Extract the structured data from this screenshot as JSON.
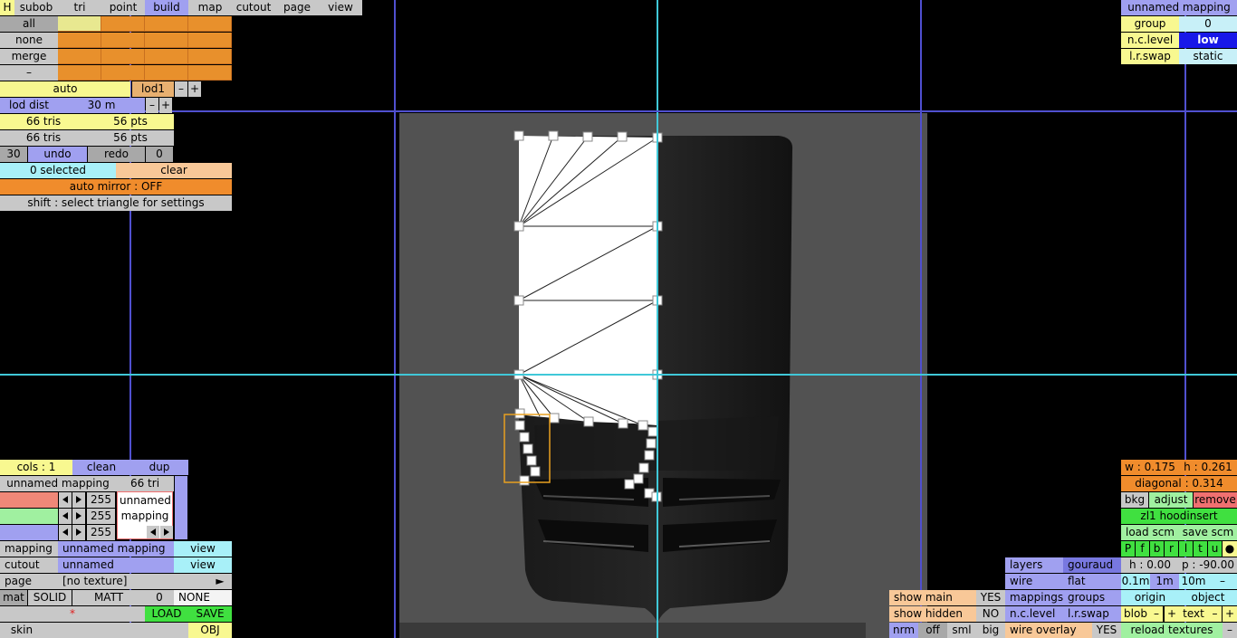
{
  "top_menu": [
    "H",
    "subob",
    "tri",
    "point",
    "build",
    "map",
    "cutout",
    "page",
    "view"
  ],
  "selection": {
    "all": "all",
    "none": "none",
    "merge": "merge",
    "dash": "–"
  },
  "lod": {
    "mode": "auto",
    "level": "lod1",
    "minus": "–",
    "plus": "+",
    "dist_label": "lod dist",
    "dist_value": "30 m"
  },
  "counts": {
    "tris_a": "66 tris",
    "pts_a": "56 pts",
    "tris_b": "66 tris",
    "pts_b": "56 pts"
  },
  "undo": {
    "left_num": "30",
    "undo": "undo",
    "redo": "redo",
    "right_num": "0"
  },
  "select": {
    "selected": "0 selected",
    "clear": "clear",
    "auto_mirror": "auto mirror : OFF",
    "hint": "shift : select triangle for settings"
  },
  "mapping_top_right": {
    "name": "unnamed mapping",
    "group_label": "group",
    "group_value": "0",
    "nc_label": "n.c.level",
    "nc_value": "low",
    "lr_label": "l.r.swap",
    "lr_value": "static"
  },
  "bottom_left": {
    "cols": "cols : 1",
    "clean": "clean",
    "dup": "dup",
    "mapping_name": "unnamed mapping",
    "tri_count": "66 tri",
    "rgb": [
      "255",
      "255",
      "255"
    ],
    "preview_text": "unnamed mapping",
    "rows": [
      {
        "label": "mapping",
        "value": "unnamed mapping",
        "action": "view"
      },
      {
        "label": "cutout",
        "value": "unnamed",
        "action": "view"
      },
      {
        "label": "page",
        "value": "[no texture]",
        "action": "►"
      }
    ],
    "mat": "mat",
    "solid": "SOLID",
    "matt": "MATT",
    "mat_num": "0",
    "mat_none": "NONE",
    "star": "*",
    "load": "LOAD",
    "save": "SAVE",
    "skin": "skin",
    "obj": "OBJ"
  },
  "bottom_right": {
    "w": "w : 0.175",
    "h": "h : 0.261",
    "diagonal": "diagonal : 0.314",
    "bkg": "bkg",
    "adjust": "adjust",
    "remove": "remove",
    "object_name": "zl1 hoodinsert",
    "load_scm": "load scm",
    "save_scm": "save scm",
    "toggles": [
      "P",
      "f",
      "b",
      "r",
      "l",
      "t",
      "u",
      "●"
    ],
    "h_angle": "h : 0.00",
    "p_angle": "p : -90.00",
    "scale": [
      "0.1m",
      "1m",
      "10m",
      "–"
    ],
    "origin": "origin",
    "object": "object",
    "blob": "blob",
    "text": "text",
    "minus": "–",
    "plus": "+",
    "reload": "reload textures",
    "end_dash": "–",
    "layers": "layers",
    "gouraud": "gouraud",
    "wire": "wire",
    "flat": "flat",
    "mappings": "mappings",
    "groups": "groups",
    "nc_level": "n.c.level",
    "lr_swap": "l.r.swap",
    "wire_overlay": "wire overlay",
    "wire_overlay_value": "YES",
    "show_main": "show main",
    "show_main_value": "YES",
    "show_hidden": "show hidden",
    "show_hidden_value": "NO",
    "nrm": "nrm",
    "off": "off",
    "sml": "sml",
    "big": "big"
  },
  "colors": {
    "accent_blue": "#a0a0f0",
    "orange": "#f08c2c",
    "yellow": "#f8f890",
    "green": "#40e040"
  }
}
